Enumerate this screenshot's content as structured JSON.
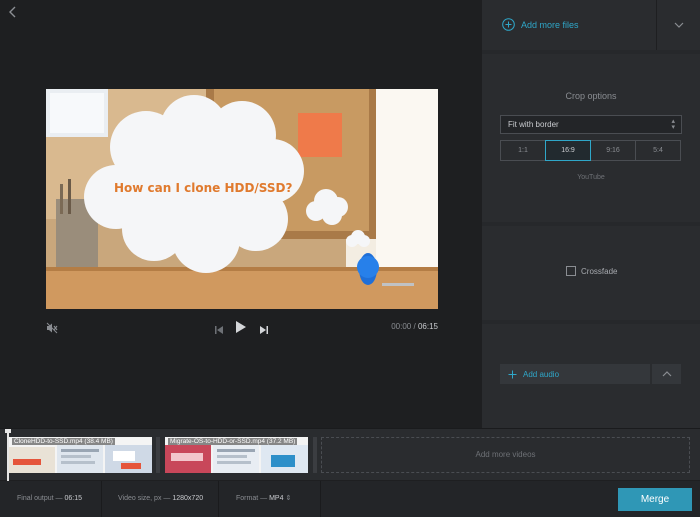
{
  "preview": {
    "caption": "How can I clone HDD/SSD?",
    "time_current": "00:00",
    "time_separator": "/",
    "time_total": "06:15",
    "icons": {
      "back": "chevron-left-icon",
      "mute": "speaker-muted-icon",
      "prev": "skip-back-icon",
      "play": "play-icon",
      "next": "skip-forward-icon"
    }
  },
  "panel": {
    "add_files_label": "Add more files",
    "crop": {
      "title": "Crop options",
      "mode": "Fit with border",
      "ratios": [
        {
          "label": "1:1",
          "active": false
        },
        {
          "label": "16:9",
          "active": true
        },
        {
          "label": "9:16",
          "active": false
        },
        {
          "label": "5:4",
          "active": false
        }
      ],
      "preset": "YouTube"
    },
    "crossfade_label": "Crossfade",
    "add_audio_label": "Add audio"
  },
  "timeline": {
    "clips": [
      {
        "name": "CloneHDD-to-SSD.mp4 (38.4 MB)"
      },
      {
        "name": "Migrate-OS-to-HDD-or-SSD.mp4 (37.2 MB)"
      }
    ],
    "add_more_label": "Add more videos"
  },
  "bottom": {
    "final_output_label": "Final output —",
    "final_output_value": "06:15",
    "video_size_label": "Video size, px —",
    "video_size_value": "1280x720",
    "format_label": "Format —",
    "format_value": "MP4",
    "merge_label": "Merge"
  },
  "colors": {
    "accent": "#2fa7c9",
    "merge_button": "#2f97b6",
    "background": "#1e1f21",
    "panel": "#2a2c2f"
  }
}
